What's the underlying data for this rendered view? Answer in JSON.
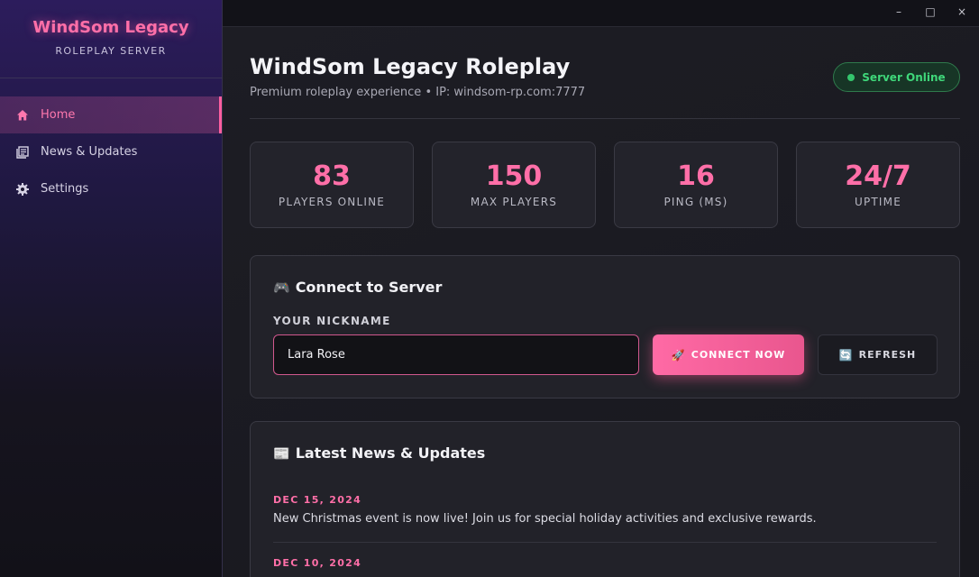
{
  "sidebar": {
    "brand_title": "WindSom Legacy",
    "brand_subtitle": "ROLEPLAY SERVER",
    "items": [
      {
        "label": "Home",
        "icon": "home-icon",
        "active": true
      },
      {
        "label": "News & Updates",
        "icon": "newspaper-icon",
        "active": false
      },
      {
        "label": "Settings",
        "icon": "gear-icon",
        "active": false
      }
    ]
  },
  "window": {
    "minimize": "–",
    "maximize": "□",
    "close": "×"
  },
  "header": {
    "title": "WindSom Legacy Roleplay",
    "subtitle": "Premium roleplay experience • IP: windsom-rp.com:7777",
    "status": "Server Online",
    "status_color": "#3fd77a"
  },
  "stats": [
    {
      "value": "83",
      "label": "PLAYERS ONLINE"
    },
    {
      "value": "150",
      "label": "MAX PLAYERS"
    },
    {
      "value": "16",
      "label": "PING (MS)"
    },
    {
      "value": "24/7",
      "label": "UPTIME"
    }
  ],
  "connect": {
    "emoji": "🎮",
    "title": "Connect to Server",
    "field_label": "YOUR NICKNAME",
    "nickname_value": "Lara Rose",
    "connect_emoji": "🚀",
    "connect_label": "CONNECT NOW",
    "refresh_emoji": "🔄",
    "refresh_label": "REFRESH"
  },
  "news": {
    "emoji": "📰",
    "title": "Latest News & Updates",
    "items": [
      {
        "date": "DEC 15, 2024",
        "text": "New Christmas event is now live! Join us for special holiday activities and exclusive rewards."
      },
      {
        "date": "DEC 10, 2024",
        "text": ""
      }
    ]
  },
  "colors": {
    "accent": "#ff6fa8",
    "sidebar_top": "#2c1c5c",
    "status_green": "#3fd77a"
  }
}
